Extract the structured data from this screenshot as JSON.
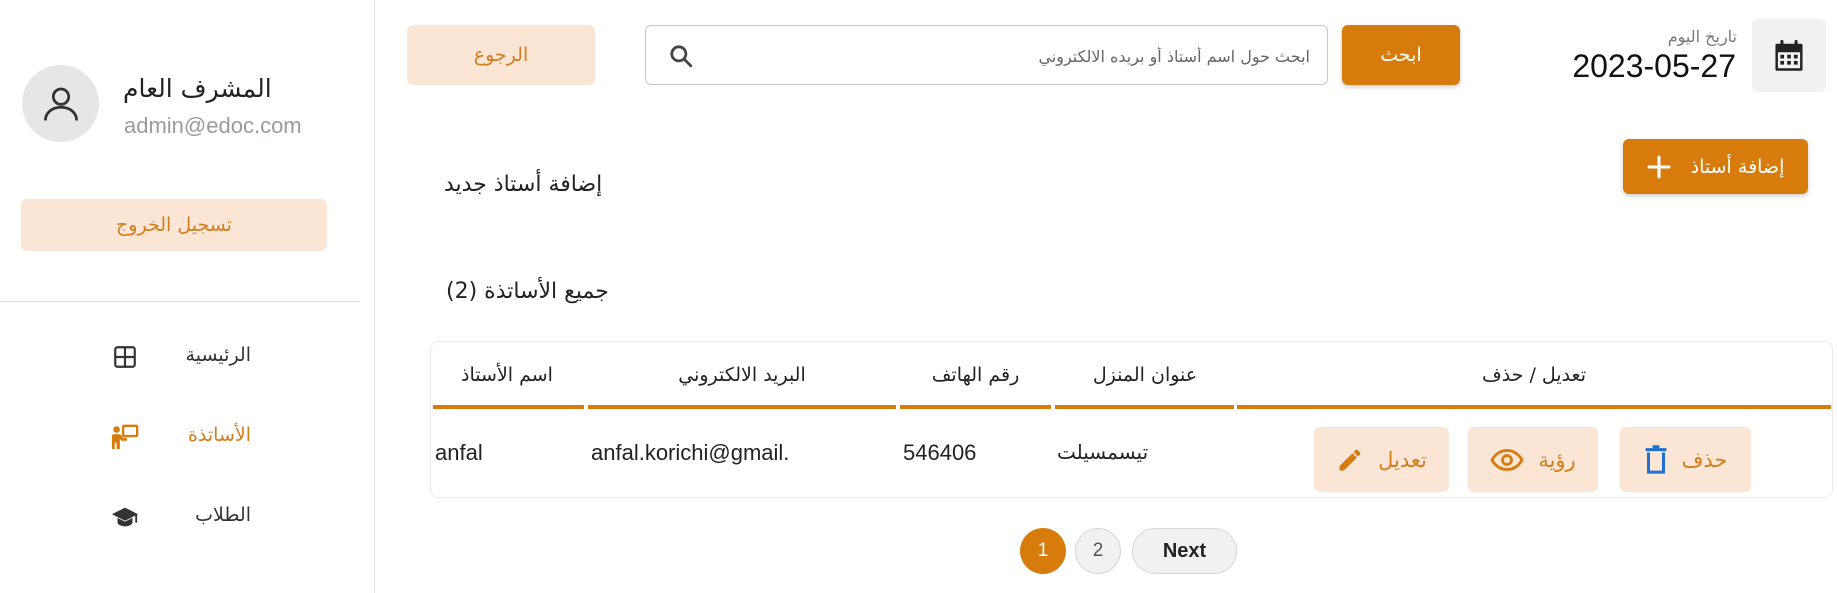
{
  "sidebar": {
    "profile": {
      "name": "المشرف العام",
      "email": "admin@edoc.com"
    },
    "logout_label": "تسجيل الخروج",
    "nav": [
      {
        "label": "الرئيسية",
        "icon": "dashboard-grid-icon",
        "active": false
      },
      {
        "label": "الأساتذة",
        "icon": "teacher-board-icon",
        "active": true
      },
      {
        "label": "الطلاب",
        "icon": "graduation-cap-icon",
        "active": false
      }
    ]
  },
  "header": {
    "back_label": "الرجوع",
    "search_placeholder": "ابحث حول اسم أستاذ أو بريده الالكتروني",
    "search_value": "",
    "search_button_label": "ابحث",
    "today_label": "تاريخ اليوم",
    "today_date": "2023-05-27",
    "calendar_icon": "calendar-icon"
  },
  "main": {
    "add_title": "إضافة أستاذ جديد",
    "add_button_label": "إضافة أستاذ",
    "list_title": "جميع الأساتذة (2)",
    "table": {
      "columns": [
        "اسم الأستاذ",
        "البريد الالكتروني",
        "رقم الهاتف",
        "عنوان المنزل",
        "تعديل / حذف"
      ],
      "rows": [
        {
          "name": "anfal",
          "email": "anfal.korichi@gmail.",
          "phone": "546406",
          "address": "تيسمسيلت",
          "actions": {
            "edit": "تعديل",
            "view": "رؤية",
            "delete": "حذف"
          }
        }
      ]
    },
    "pagination": {
      "pages": [
        "1",
        "2"
      ],
      "current": "1",
      "next_label": "Next"
    }
  },
  "colors": {
    "accent": "#d67b0c",
    "accent_light": "#fbe6d6",
    "accent_text": "#d27e1b"
  }
}
